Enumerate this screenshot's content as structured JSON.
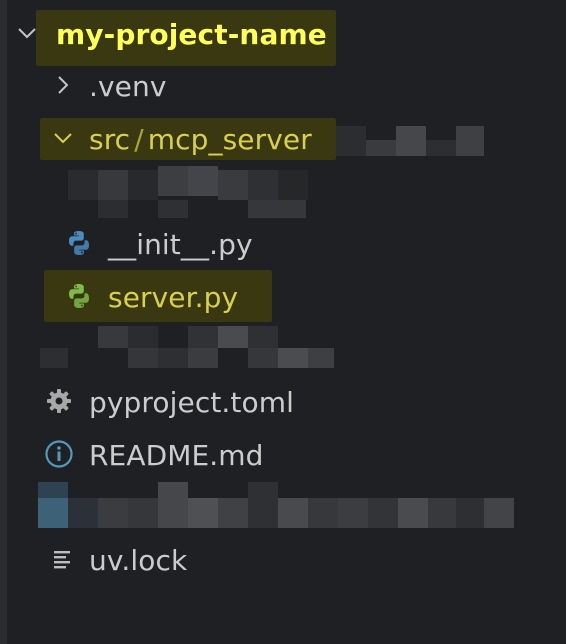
{
  "explorer": {
    "root": {
      "label": "my-project-name",
      "icon": "chevron-down-icon"
    },
    "items": [
      {
        "label": ".venv",
        "icon": "chevron-right-icon"
      },
      {
        "path_parts": [
          "src",
          "mcp_server"
        ],
        "icon": "chevron-down-icon"
      },
      {
        "label": "__init__.py",
        "icon": "python-icon"
      },
      {
        "label": "server.py",
        "icon": "python-icon"
      },
      {
        "label": "pyproject.toml",
        "icon": "gear-icon"
      },
      {
        "label": "README.md",
        "icon": "info-icon"
      },
      {
        "label": "uv.lock",
        "icon": "lines-icon"
      }
    ]
  },
  "colors": {
    "background": "#1f2023",
    "highlight": "#3a3811",
    "highlight_text": "#ffff5c",
    "folder_text": "#d9d04e",
    "python_blue": "#4b8bbe",
    "python_green": "#7fba4a",
    "info_blue": "#519aba"
  }
}
